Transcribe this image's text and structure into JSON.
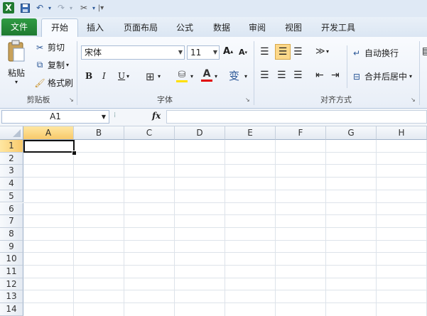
{
  "qat": {
    "icons": [
      "excel-logo-icon",
      "save-icon",
      "undo-icon",
      "redo-icon",
      "customize-icon"
    ]
  },
  "tabs": [
    "文件",
    "开始",
    "插入",
    "页面布局",
    "公式",
    "数据",
    "审阅",
    "视图",
    "开发工具"
  ],
  "ribbon": {
    "clipboard": {
      "paste": "粘贴",
      "cut": "剪切",
      "copy": "复制",
      "format_painter": "格式刷",
      "label": "剪贴板"
    },
    "font": {
      "font_name": "宋体",
      "font_size": "11",
      "label": "字体",
      "bold": "B",
      "italic": "I",
      "underline": "U"
    },
    "alignment": {
      "wrap_text": "自动换行",
      "merge_center": "合并后居中",
      "label": "对齐方式"
    }
  },
  "formula_bar": {
    "name_box": "A1",
    "fx": "fx",
    "value": ""
  },
  "grid": {
    "columns": [
      "A",
      "B",
      "C",
      "D",
      "E",
      "F",
      "G",
      "H"
    ],
    "rows": [
      "1",
      "2",
      "3",
      "4",
      "5",
      "6",
      "7",
      "8",
      "9",
      "10",
      "11",
      "12",
      "13",
      "14"
    ],
    "selected_cell": "A1"
  },
  "colors": {
    "file_tab": "#1f7a31",
    "selection": "#f8c96a",
    "accent": "#2b5797"
  }
}
